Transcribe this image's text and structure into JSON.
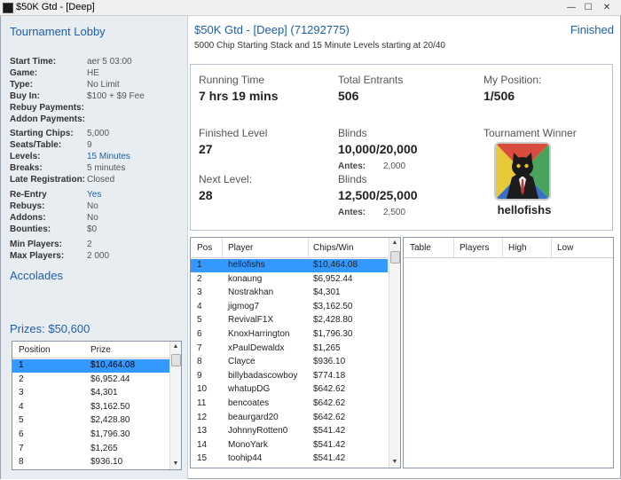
{
  "window": {
    "title": "$50K Gtd - [Deep]"
  },
  "left": {
    "lobby_title": "Tournament Lobby",
    "info": [
      {
        "k": "Start Time:",
        "v": "aer 5 03:00"
      },
      {
        "k": "Game:",
        "v": "HE"
      },
      {
        "k": "Type:",
        "v": "No Limit"
      },
      {
        "k": "Buy In:",
        "v": "$100 + $9 Fee"
      },
      {
        "k": "Rebuy Payments:",
        "v": ""
      },
      {
        "k": "Addon Payments:",
        "v": ""
      },
      {
        "k": "Starting Chips:",
        "v": "5,000"
      },
      {
        "k": "Seats/Table:",
        "v": "9"
      },
      {
        "k": "Levels:",
        "v": "15 Minutes"
      },
      {
        "k": "Breaks:",
        "v": "5 minutes"
      },
      {
        "k": "Late Registration:",
        "v": "Closed"
      },
      {
        "k": "Re-Entry",
        "v": "Yes"
      },
      {
        "k": "Rebuys:",
        "v": "No"
      },
      {
        "k": "Addons:",
        "v": "No"
      },
      {
        "k": "Bounties:",
        "v": "$0"
      },
      {
        "k": "Min Players:",
        "v": "2"
      },
      {
        "k": "Max Players:",
        "v": "2 000"
      }
    ],
    "accolades": "Accolades",
    "prizes_title": "Prizes: $50,600",
    "prize_headers": [
      "Position",
      "Prize"
    ],
    "prizes": [
      [
        "1",
        "$10,464.08"
      ],
      [
        "2",
        "$6,952.44"
      ],
      [
        "3",
        "$4,301"
      ],
      [
        "4",
        "$3,162.50"
      ],
      [
        "5",
        "$2,428.80"
      ],
      [
        "6",
        "$1,796.30"
      ],
      [
        "7",
        "$1,265"
      ],
      [
        "8",
        "$936.10"
      ]
    ]
  },
  "main": {
    "title": "$50K Gtd - [Deep] (71292775)",
    "status": "Finished",
    "subtitle": "5000 Chip Starting Stack and 15 Minute Levels starting at 20/40",
    "stats": {
      "running_time_label": "Running Time",
      "running_time": "7 hrs 19 mins",
      "entrants_label": "Total Entrants",
      "entrants": "506",
      "my_pos_label": "My Position:",
      "my_pos": "1/506",
      "finished_level_label": "Finished Level",
      "finished_level": "27",
      "blinds_label": "Blinds",
      "blinds": "10,000/20,000",
      "antes_label": "Antes:",
      "antes": "2,000",
      "next_level_label": "Next Level:",
      "next_level": "28",
      "next_blinds_label": "Blinds",
      "next_blinds": "12,500/25,000",
      "next_antes_label": "Antes:",
      "next_antes": "2,500",
      "winner_label": "Tournament Winner",
      "winner_name": "hellofishs"
    },
    "players_headers": [
      "Pos",
      "Player",
      "Chips/Win"
    ],
    "players": [
      [
        "1",
        "hellofishs",
        "$10,464.08"
      ],
      [
        "2",
        "konaung",
        "$6,952.44"
      ],
      [
        "3",
        "Nostrakhan",
        "$4,301"
      ],
      [
        "4",
        "jigmog7",
        "$3,162.50"
      ],
      [
        "5",
        "RevivalF1X",
        "$2,428.80"
      ],
      [
        "6",
        "KnoxHarrington",
        "$1,796.30"
      ],
      [
        "7",
        "xPaulDewaldx",
        "$1,265"
      ],
      [
        "8",
        "Clayce",
        "$936.10"
      ],
      [
        "9",
        "billybadascowboy",
        "$774.18"
      ],
      [
        "10",
        "whatupDG",
        "$642.62"
      ],
      [
        "11",
        "bencoates",
        "$642.62"
      ],
      [
        "12",
        "beaurgard20",
        "$642.62"
      ],
      [
        "13",
        "JohnnyRotten0",
        "$541.42"
      ],
      [
        "14",
        "MonoYark",
        "$541.42"
      ],
      [
        "15",
        "toohip44",
        "$541.42"
      ]
    ],
    "tables_headers": [
      "Table",
      "Players",
      "High",
      "Low"
    ]
  },
  "colors": {
    "accent": "#1f5fa8",
    "selection": "#3399ff",
    "sidebar_bg": "#e8edf2"
  }
}
